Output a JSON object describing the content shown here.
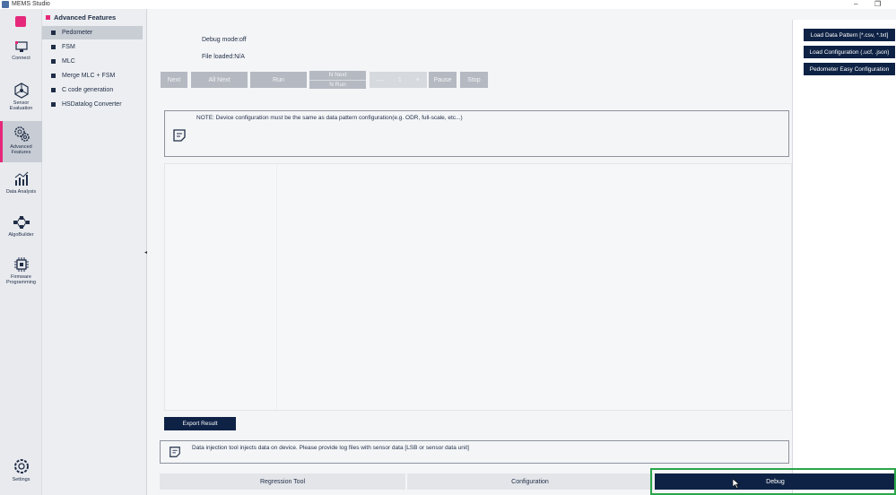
{
  "window": {
    "title": "MEMS Studio",
    "restore_glyph": "❐"
  },
  "rail": {
    "items": [
      {
        "label": "Connect",
        "icon": "connect-icon"
      },
      {
        "label": "Sensor Evaluation",
        "icon": "sensor-evaluation-icon"
      },
      {
        "label": "Advanced Features",
        "icon": "gears-icon"
      },
      {
        "label": "Data Analysis",
        "icon": "chart-icon"
      },
      {
        "label": "AlgoBuilder",
        "icon": "flow-icon"
      },
      {
        "label": "Firmware Programming",
        "icon": "chip-icon"
      }
    ],
    "settings_label": "Settings",
    "accent": "#e6287a"
  },
  "submenu": {
    "title": "Advanced Features",
    "items": [
      "Pedometer",
      "FSM",
      "MLC",
      "Merge MLC + FSM",
      "C code generation",
      "HSDatalog Converter"
    ]
  },
  "status": {
    "debug_mode": "Debug mode:off",
    "file_loaded": "File loaded:N/A"
  },
  "controls": {
    "next": "Next",
    "all_next": "All Next",
    "run": "Run",
    "n_next": "N Next",
    "n_run": "N Run",
    "minus": "—",
    "step_value": "1",
    "plus": "+",
    "pause": "Pause",
    "stop": "Stop"
  },
  "note": "NOTE: Device configuration must be the same as data pattern configuration(e.g. ODR, full-scale, etc...)",
  "export_label": "Export Result",
  "info_text": "Data injection tool injects data on device. Please provide log files with sensor data [LSB or sensor data unit]",
  "right_panel": {
    "load_pattern": "Load Data Pattern [*.csv, *.txt]",
    "load_config": "Load Configuration (.ucf, .json)",
    "pedometer_config": "Pedometer Easy Configuration"
  },
  "tabs": {
    "regression": "Regression Tool",
    "configuration": "Configuration",
    "debug": "Debug"
  },
  "colors": {
    "dark": "#0e2245",
    "disabled": "#b5b9c1",
    "highlight": "#2aa64a"
  }
}
